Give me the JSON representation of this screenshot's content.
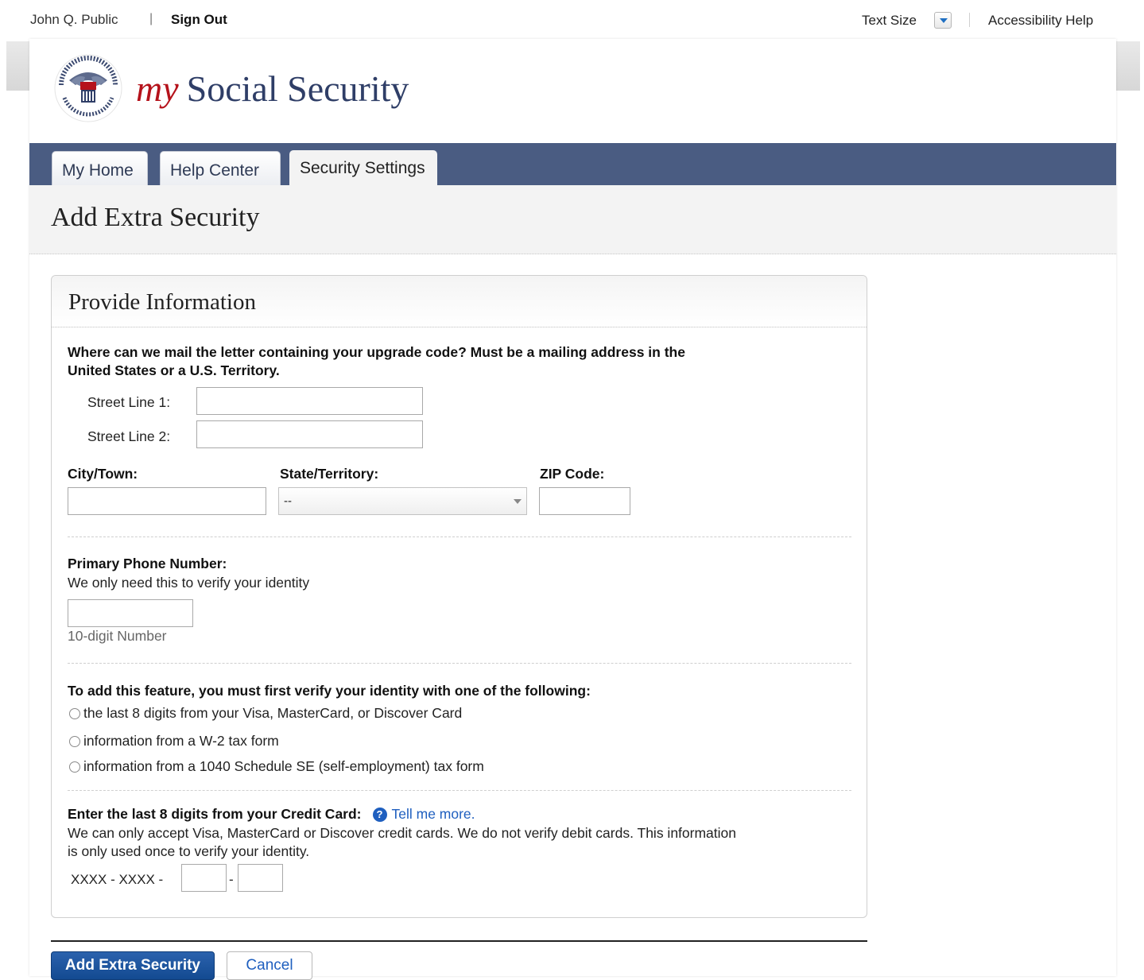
{
  "utility": {
    "user_name": "John Q. Public",
    "divider": "|",
    "sign_out": "Sign Out",
    "text_size": "Text Size",
    "accessibility_help": "Accessibility Help"
  },
  "header": {
    "brand_my": "my",
    "brand_rest": "Social Security",
    "seal_text": "SOCIAL SECURITY ADMINISTRATION USA"
  },
  "nav": {
    "tabs": [
      {
        "label": "My Home",
        "active": false
      },
      {
        "label": "Help Center",
        "active": false
      },
      {
        "label": "Security Settings",
        "active": true
      }
    ]
  },
  "page": {
    "title": "Add Extra Security"
  },
  "form": {
    "panel_title": "Provide Information",
    "mail_question_line1": "Where can we mail the letter containing your upgrade code? Must be a mailing address in the",
    "mail_question_line2": "United States or a U.S. Territory.",
    "street1_label": "Street Line 1:",
    "street1_value": "",
    "street2_label": "Street Line 2:",
    "street2_value": "",
    "city_label": "City/Town:",
    "city_value": "",
    "state_label": "State/Territory:",
    "state_value": "--",
    "zip_label": "ZIP Code:",
    "zip_value": "",
    "phone_label": "Primary Phone Number:",
    "phone_note": "We only need this to verify your identity",
    "phone_value": "",
    "phone_hint": "10-digit Number",
    "verify_question": "To add this feature, you must first verify your identity with one of the following:",
    "verify_options": [
      "the last 8 digits from your Visa, MasterCard, or Discover Card",
      "information from a W-2 tax form",
      "information from a 1040 Schedule SE (self-employment) tax form"
    ],
    "cc_label": "Enter the last 8 digits from your Credit Card:",
    "cc_help_icon": "?",
    "cc_help_link": "Tell me more.",
    "cc_note_line1": "We can only accept Visa, MasterCard or Discover credit cards. We do not verify debit cards. This information",
    "cc_note_line2": "is only used once to verify your identity.",
    "cc_prefix": "XXXX - XXXX -",
    "cc_dash": "-",
    "cc_part1": "",
    "cc_part2": ""
  },
  "actions": {
    "submit": "Add Extra Security",
    "cancel": "Cancel"
  },
  "colors": {
    "nav_bar": "#4a5c82",
    "brand_red": "#b5121b",
    "brand_navy": "#2f3e67",
    "primary_button": "#1f58a3",
    "link": "#1f5fbf"
  }
}
